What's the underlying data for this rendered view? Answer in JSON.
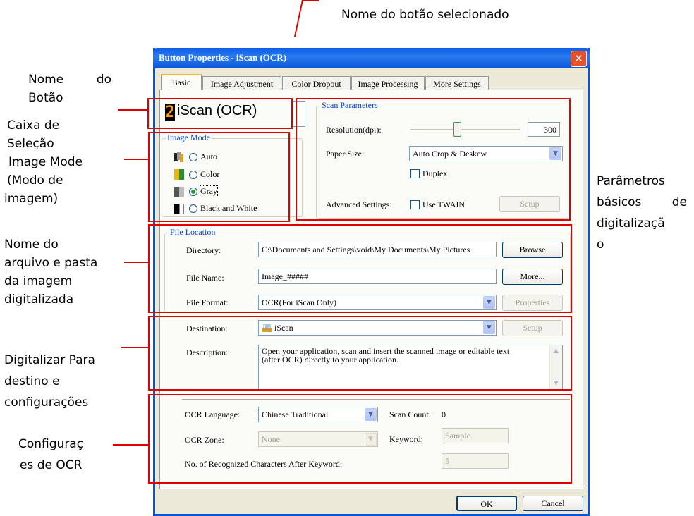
{
  "top_callout": "Nome do botão selecionado",
  "callouts": {
    "button_name": "Nome do Botão",
    "image_mode": [
      "Caixa de",
      "Seleção",
      "Image Mode",
      "(Modo de",
      "imagem)"
    ],
    "file": [
      "Nome do",
      "arquivo e pasta",
      "da imagem",
      "digitalizada"
    ],
    "destination": [
      "Digitalizar Para",
      "destino e",
      "configurações"
    ],
    "ocr": [
      "Configuraç",
      "es de OCR"
    ],
    "scan_params": [
      "Parâmetros",
      "básicos de",
      "digitalizaçã",
      "o"
    ]
  },
  "dialog": {
    "title": "Button Properties - iScan (OCR)",
    "close": "✕",
    "tabs": [
      "Basic",
      "Image Adjustment",
      "Color Dropout",
      "Image Processing",
      "More Settings"
    ],
    "button_number": "2",
    "button_name": "iScan (OCR)",
    "image_mode": {
      "title": "Image Mode",
      "options": [
        "Auto",
        "Color",
        "Gray",
        "Black and White"
      ],
      "selected": "Gray"
    },
    "scan_parameters": {
      "title": "Scan Parameters",
      "resolution_label": "Resolution(dpi):",
      "resolution_value": "300",
      "paper_size_label": "Paper Size:",
      "paper_size_value": "Auto Crop & Deskew",
      "duplex_label": "Duplex",
      "advanced_label": "Advanced Settings:",
      "twain_label": "Use TWAIN",
      "setup_label": "Setup"
    },
    "file_location": {
      "title": "File Location",
      "directory_label": "Directory:",
      "directory_value": "C:\\Documents and Settings\\void\\My Documents\\My Pictures",
      "browse_label": "Browse",
      "file_name_label": "File Name:",
      "file_name_value": "Image_#####",
      "more_label": "More...",
      "file_format_label": "File Format:",
      "file_format_value": "OCR(For iScan Only)",
      "properties_label": "Properties"
    },
    "destination": {
      "label": "Destination:",
      "value": "iScan",
      "setup_label": "Setup",
      "description_label": "Description:",
      "description_line1": "Open your application, scan and insert the scanned image or editable text",
      "description_line2": "(after OCR) directly to your application."
    },
    "ocr": {
      "language_label": "OCR Language:",
      "language_value": "Chinese Traditional",
      "scan_count_label": "Scan Count:",
      "scan_count_value": "0",
      "zone_label": "OCR Zone:",
      "zone_value": "None",
      "keyword_label": "Keyword:",
      "keyword_value": "Sample",
      "recognized_label": "No. of Recognized Characters After Keyword:",
      "recognized_value": "5"
    },
    "ok_label": "OK",
    "cancel_label": "Cancel"
  },
  "colors": {
    "annotation": "#e00000",
    "title_bar": "#0a5ae0",
    "group_title": "#0046d5"
  }
}
